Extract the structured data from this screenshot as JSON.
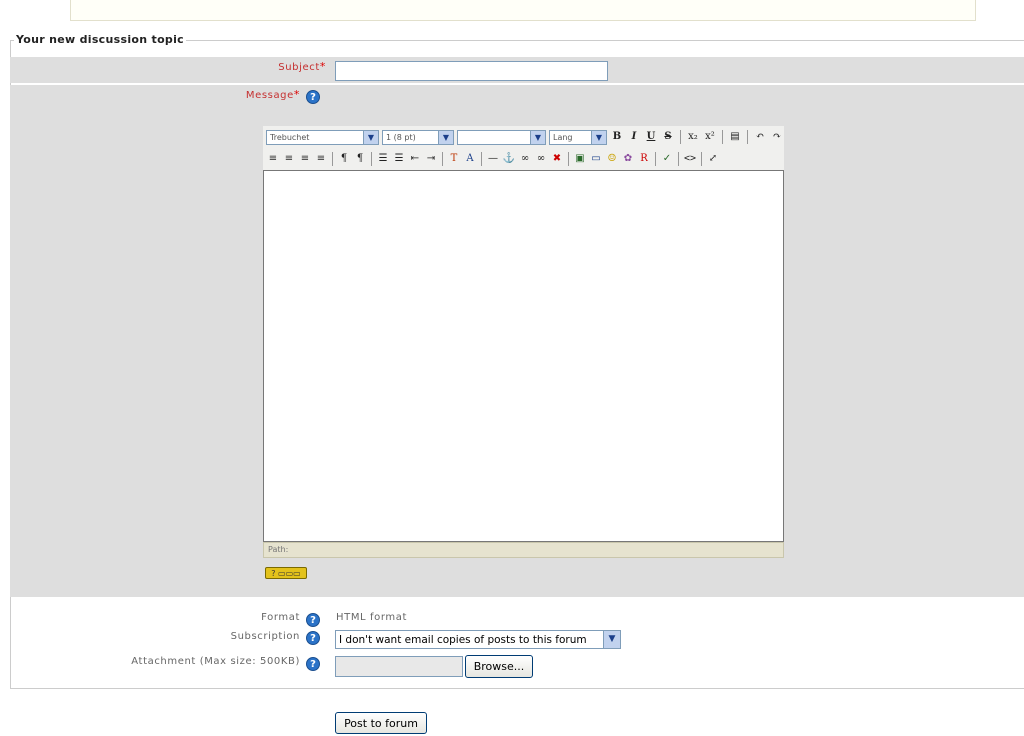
{
  "form": {
    "legend": "Your new discussion topic",
    "subject": {
      "label": "Subject",
      "required_mark": "*",
      "value": ""
    },
    "message": {
      "label": "Message",
      "required_mark": "*"
    },
    "editor": {
      "font_family": "Trebuchet",
      "font_size": "1 (8 pt)",
      "style": "",
      "lang": "Lang",
      "toolbar_row1": [
        "B",
        "I",
        "U",
        "S",
        "x₂",
        "x²",
        "▤",
        "↶",
        "↷"
      ],
      "toolbar_row2": [
        "≡",
        "≡",
        "≡",
        "≡",
        "¶",
        "¶",
        "☰",
        "☰",
        "⇤",
        "⇥",
        "T",
        "A",
        "—",
        "⚓",
        "∞",
        "∞",
        "✖",
        "▣",
        "▭",
        "☺",
        "✿",
        "R",
        "✓",
        "<>",
        "⤢"
      ],
      "path_label": "Path:",
      "content": ""
    },
    "format": {
      "label": "Format",
      "value": "HTML format"
    },
    "subscription": {
      "label": "Subscription",
      "selected": "I don't want email copies of posts to this forum"
    },
    "attachment": {
      "label": "Attachment (Max size: 500KB)",
      "browse_label": "Browse..."
    },
    "submit_label": "Post to forum",
    "help_glyph": "?"
  },
  "colors": {
    "required": "#c53030",
    "band": "#dedede",
    "help": "#2b73c8"
  }
}
